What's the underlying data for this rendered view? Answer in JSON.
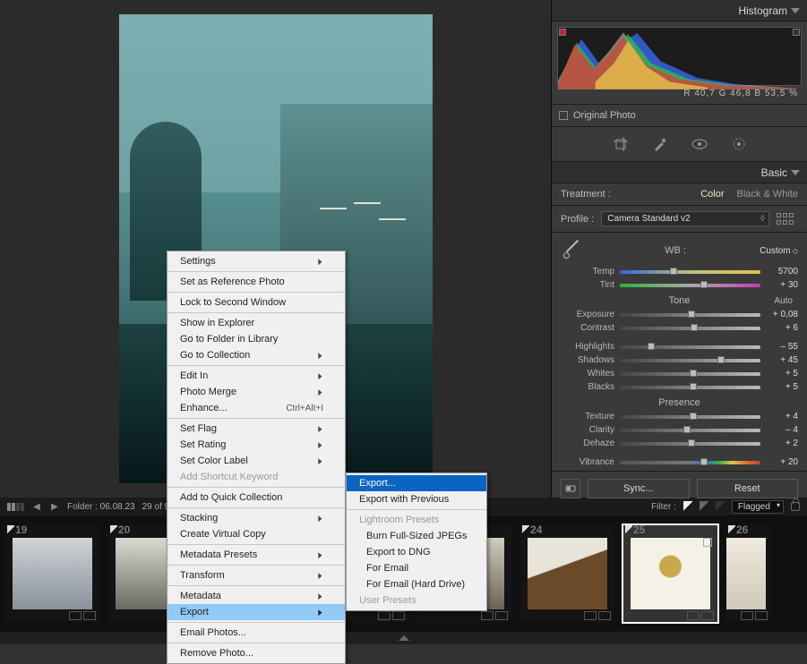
{
  "panel": {
    "histogram": "Histogram",
    "basic": "Basic"
  },
  "histo_readout": "R   40,7    G   46,8    B   53,5  %",
  "original_photo": "Original Photo",
  "treatment": {
    "label": "Treatment :",
    "color": "Color",
    "bw": "Black & White"
  },
  "profile": {
    "label": "Profile :",
    "value": "Camera Standard v2"
  },
  "wb": {
    "label": "WB :",
    "value": "Custom"
  },
  "tone_label": "Tone",
  "auto": "Auto",
  "presence_label": "Presence",
  "sliders": {
    "temp": {
      "label": "Temp",
      "value": "5700",
      "pos": 38
    },
    "tint": {
      "label": "Tint",
      "value": "+ 30",
      "pos": 60
    },
    "exposure": {
      "label": "Exposure",
      "value": "+ 0,08",
      "pos": 51
    },
    "contrast": {
      "label": "Contrast",
      "value": "+ 6",
      "pos": 53
    },
    "highlights": {
      "label": "Highlights",
      "value": "– 55",
      "pos": 22
    },
    "shadows": {
      "label": "Shadows",
      "value": "+ 45",
      "pos": 72
    },
    "whites": {
      "label": "Whites",
      "value": "+ 5",
      "pos": 52
    },
    "blacks": {
      "label": "Blacks",
      "value": "+ 5",
      "pos": 52
    },
    "texture": {
      "label": "Texture",
      "value": "+ 4",
      "pos": 52
    },
    "clarity": {
      "label": "Clarity",
      "value": "– 4",
      "pos": 48
    },
    "dehaze": {
      "label": "Dehaze",
      "value": "+ 2",
      "pos": 51
    },
    "vibrance": {
      "label": "Vibrance",
      "value": "+ 20",
      "pos": 60
    }
  },
  "sync": "Sync...",
  "reset": "Reset",
  "folder": "Folder : 06.08.23",
  "count": "29 of 901",
  "filter_label": "Filter :",
  "filter_value": "Flagged",
  "thumbs": [
    "19",
    "20",
    "",
    "",
    "",
    "24",
    "25",
    "26"
  ],
  "menu1": [
    {
      "t": "Settings",
      "sub": true
    },
    {
      "sep": true
    },
    {
      "t": "Set as Reference Photo"
    },
    {
      "sep": true
    },
    {
      "t": "Lock to Second Window"
    },
    {
      "sep": true
    },
    {
      "t": "Show in Explorer"
    },
    {
      "t": "Go to Folder in Library"
    },
    {
      "t": "Go to Collection",
      "sub": true
    },
    {
      "sep": true
    },
    {
      "t": "Edit In",
      "sub": true
    },
    {
      "t": "Photo Merge",
      "sub": true
    },
    {
      "t": "Enhance...",
      "sc": "Ctrl+Alt+I"
    },
    {
      "sep": true
    },
    {
      "t": "Set Flag",
      "sub": true
    },
    {
      "t": "Set Rating",
      "sub": true
    },
    {
      "t": "Set Color Label",
      "sub": true
    },
    {
      "t": "Add Shortcut Keyword",
      "disabled": true
    },
    {
      "sep": true
    },
    {
      "t": "Add to Quick Collection"
    },
    {
      "sep": true
    },
    {
      "t": "Stacking",
      "sub": true
    },
    {
      "t": "Create Virtual Copy"
    },
    {
      "sep": true
    },
    {
      "t": "Metadata Presets",
      "sub": true
    },
    {
      "sep": true
    },
    {
      "t": "Transform",
      "sub": true
    },
    {
      "sep": true
    },
    {
      "t": "Metadata",
      "sub": true
    },
    {
      "t": "Export",
      "sub": true,
      "hl": true
    },
    {
      "sep": true
    },
    {
      "t": "Email Photos..."
    },
    {
      "sep": true
    },
    {
      "t": "Remove Photo..."
    }
  ],
  "menu2": [
    {
      "t": "Export...",
      "sel": true
    },
    {
      "t": "Export with Previous"
    },
    {
      "sep": true
    },
    {
      "t": "Lightroom Presets",
      "disabled": true
    },
    {
      "t": "Burn Full-Sized JPEGs",
      "ind": true
    },
    {
      "t": "Export to DNG",
      "ind": true
    },
    {
      "t": "For Email",
      "ind": true
    },
    {
      "t": "For Email (Hard Drive)",
      "ind": true
    },
    {
      "t": "User Presets",
      "disabled": true
    }
  ],
  "chart_data": {
    "type": "area",
    "title": "Histogram",
    "xlabel": "",
    "ylabel": "",
    "xlim": [
      0,
      255
    ],
    "ylim": [
      0,
      100
    ],
    "readout": {
      "R": 40.7,
      "G": 46.8,
      "B": 53.5,
      "unit": "%"
    },
    "clipping": {
      "shadow": true,
      "highlight": false
    },
    "series": [
      {
        "name": "luminance",
        "color": "#cccccc",
        "x": [
          0,
          20,
          40,
          60,
          70,
          80,
          100,
          130,
          170,
          210,
          255
        ],
        "y": [
          8,
          45,
          25,
          50,
          95,
          60,
          30,
          18,
          10,
          4,
          1
        ]
      },
      {
        "name": "blue",
        "color": "#3a6cff",
        "x": [
          0,
          25,
          45,
          70,
          85,
          110,
          150,
          200,
          255
        ],
        "y": [
          10,
          55,
          30,
          70,
          90,
          40,
          20,
          6,
          1
        ]
      },
      {
        "name": "green",
        "color": "#2fbf3a",
        "x": [
          0,
          20,
          40,
          60,
          75,
          100,
          140,
          190,
          255
        ],
        "y": [
          8,
          50,
          28,
          55,
          88,
          35,
          16,
          5,
          1
        ]
      },
      {
        "name": "red",
        "color": "#e03a3a",
        "x": [
          0,
          18,
          38,
          55,
          70,
          95,
          130,
          180,
          255
        ],
        "y": [
          6,
          48,
          24,
          45,
          80,
          30,
          14,
          4,
          1
        ]
      },
      {
        "name": "yellow",
        "color": "#e5c24a",
        "x": [
          40,
          60,
          75,
          95,
          120,
          160
        ],
        "y": [
          10,
          35,
          70,
          28,
          12,
          3
        ]
      }
    ]
  }
}
